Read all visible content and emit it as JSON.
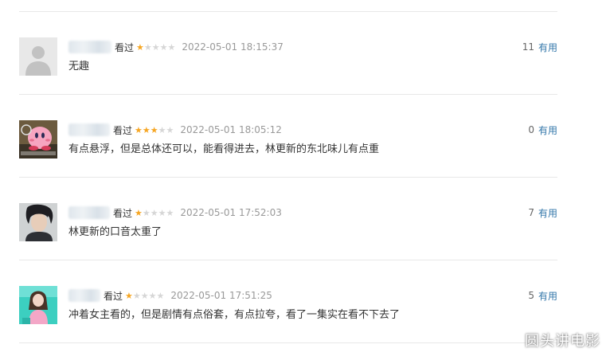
{
  "colors": {
    "accent_link": "#3377aa",
    "star_on": "#f6a623",
    "star_off": "#d6d6d6"
  },
  "comments": [
    {
      "avatar_icon": "default-user-avatar-icon",
      "watched_label": "看过",
      "rating_stars": 1,
      "time": "2022-05-01 18:15:37",
      "vote_count": "11",
      "useful_label": "有用",
      "text": "无趣"
    },
    {
      "avatar_icon": "kirby-avatar-icon",
      "watched_label": "看过",
      "rating_stars": 3,
      "time": "2022-05-01 18:05:12",
      "vote_count": "0",
      "useful_label": "有用",
      "text": "有点悬浮，但是总体还可以，能看得进去，林更新的东北味儿有点重"
    },
    {
      "avatar_icon": "portrait-avatar-icon",
      "watched_label": "看过",
      "rating_stars": 1,
      "time": "2022-05-01 17:52:03",
      "vote_count": "7",
      "useful_label": "有用",
      "text": "林更新的口音太重了"
    },
    {
      "avatar_icon": "girl-photo-avatar-icon",
      "watched_label": "看过",
      "rating_stars": 1,
      "time": "2022-05-01 17:51:25",
      "vote_count": "5",
      "useful_label": "有用",
      "text": "冲着女主看的，但是剧情有点俗套，有点拉夸，看了一集实在看不下去了"
    }
  ],
  "watermark": "圆头讲电影"
}
